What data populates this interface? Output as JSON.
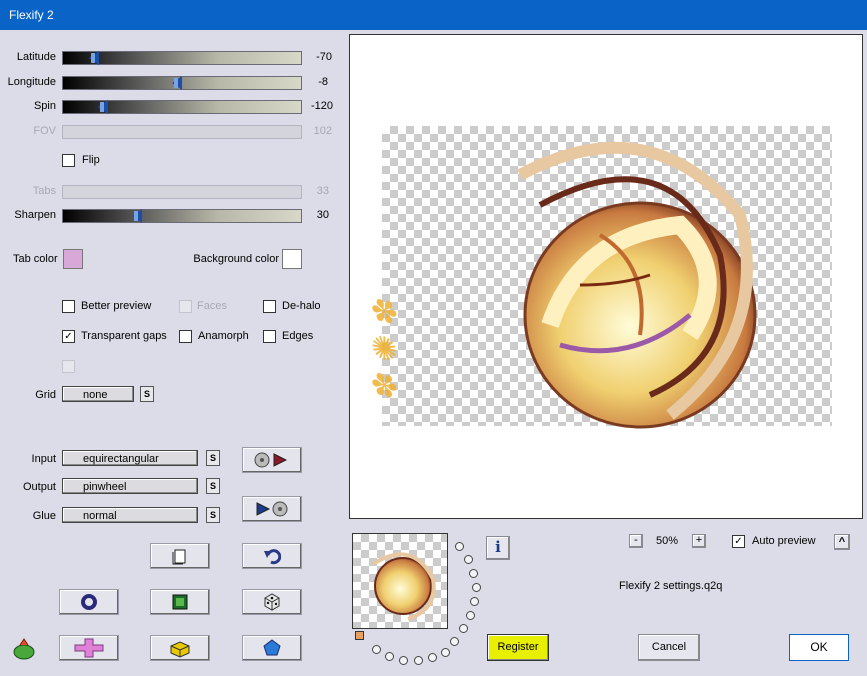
{
  "window": {
    "title": "Flexify 2"
  },
  "controls": {
    "latitude": {
      "label": "Latitude",
      "value": "-70",
      "fraction": 0.13
    },
    "longitude": {
      "label": "Longitude",
      "value": "-8",
      "fraction": 0.48
    },
    "spin": {
      "label": "Spin",
      "value": "-120",
      "fraction": 0.17
    },
    "fov": {
      "label": "FOV",
      "value": "102"
    },
    "flip": {
      "label": "Flip",
      "checked": false
    },
    "tabs": {
      "label": "Tabs",
      "value": "33"
    },
    "sharpen": {
      "label": "Sharpen",
      "value": "30",
      "fraction": 0.31
    }
  },
  "colors": {
    "tab_color_label": "Tab color",
    "tab_color": "#d8a8d8",
    "background_color_label": "Background color",
    "background_color": "#ffffff",
    "accent": "#0a64c8",
    "register_bg": "#e8f000"
  },
  "options": {
    "better_preview": {
      "label": "Better preview",
      "checked": false
    },
    "faces": {
      "label": "Faces",
      "checked": false
    },
    "dehalo": {
      "label": "De-halo",
      "checked": false
    },
    "transparent_gaps": {
      "label": "Transparent gaps",
      "checked": true
    },
    "anamorph": {
      "label": "Anamorph",
      "checked": false
    },
    "edges": {
      "label": "Edges",
      "checked": false
    },
    "check_mark": "✓"
  },
  "grid": {
    "label": "Grid",
    "value": "none",
    "s": "S"
  },
  "projection": {
    "input": {
      "label": "Input",
      "value": "equirectangular"
    },
    "output": {
      "label": "Output",
      "value": "pinwheel"
    },
    "glue": {
      "label": "Glue",
      "value": "normal"
    },
    "s": "S"
  },
  "zoom": {
    "minus": "-",
    "value": "50%",
    "plus": "+"
  },
  "auto_preview": {
    "label": "Auto preview",
    "checked": true,
    "caret": "^"
  },
  "settings_file": "Flexify 2 settings.q2q",
  "info_icon": "i",
  "buttons": {
    "register": "Register",
    "cancel": "Cancel",
    "ok": "OK"
  }
}
